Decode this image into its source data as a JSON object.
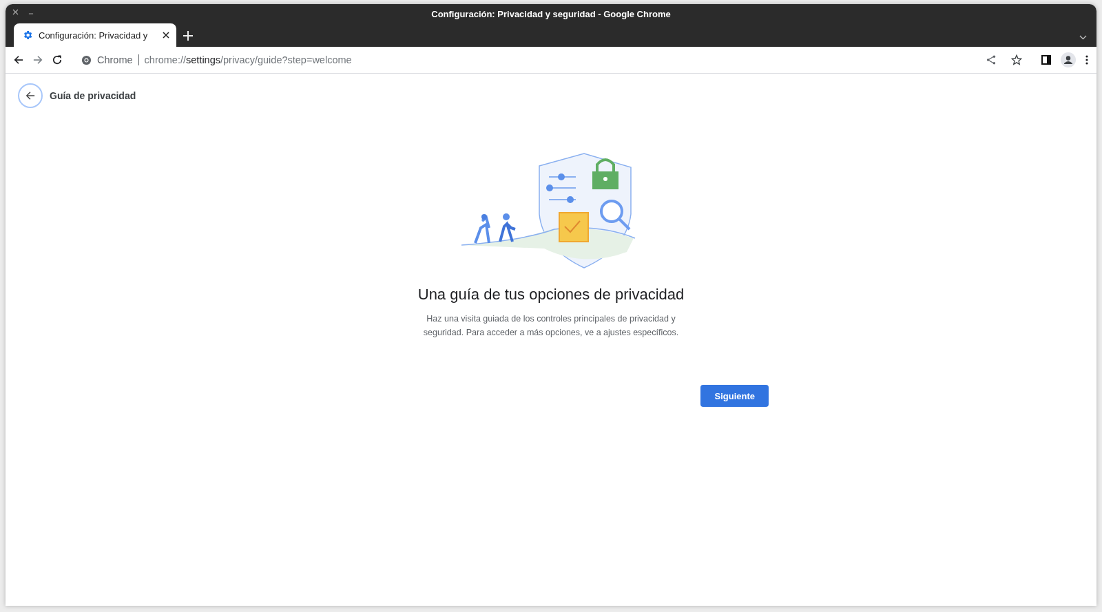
{
  "window": {
    "title": "Configuración: Privacidad y seguridad - Google Chrome"
  },
  "tabs": [
    {
      "label": "Configuración: Privacidad y",
      "selected": true
    }
  ],
  "address_bar": {
    "site_label": "Chrome",
    "url_scheme": "chrome://",
    "url_host": "settings",
    "url_path": "/privacy/guide?step=welcome"
  },
  "page": {
    "header": "Guía de privacidad",
    "heading": "Una guía de tus opciones de privacidad",
    "description": "Haz una visita guiada de los controles principales de privacidad y seguridad. Para acceder a más opciones, ve a ajustes específicos.",
    "next_button": "Siguiente"
  }
}
